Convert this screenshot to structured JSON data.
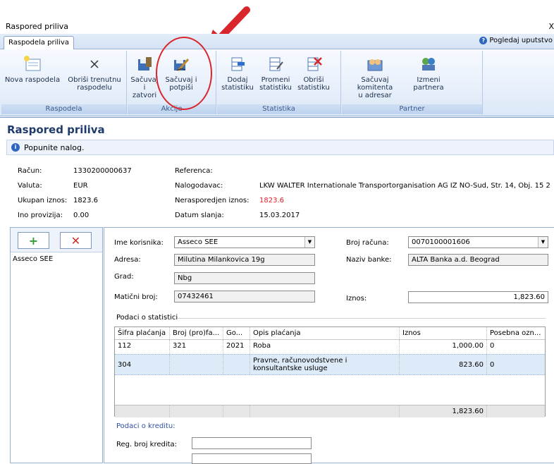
{
  "window": {
    "title": "Raspored priliva",
    "close": "X"
  },
  "tabs": {
    "active": "Raspodela priliva",
    "help": "Pogledaj uputstvo",
    "help_icon": "?"
  },
  "ribbon": {
    "groups": {
      "raspodela": "Raspodela",
      "akcije": "Akcije",
      "statistika": "Statistika",
      "partner": "Partner"
    },
    "buttons": {
      "nova": "Nova raspodela",
      "obrisi_a": "Obriši trenutnu",
      "obrisi_b": "raspodelu",
      "sacuvaj_zatvori_a": "Sačuvaj i",
      "sacuvaj_zatvori_b": "zatvori",
      "sacuvaj_potpisi_a": "Sačuvaj i",
      "sacuvaj_potpisi_b": "potpiši",
      "dodaj_a": "Dodaj",
      "dodaj_b": "statistiku",
      "promeni_a": "Promeni",
      "promeni_b": "statistiku",
      "obrisi_stat_a": "Obriši",
      "obrisi_stat_b": "statistiku",
      "sacuvaj_kom_a": "Sačuvaj komitenta",
      "sacuvaj_kom_b": "u adresar",
      "izmeni_a": "Izmeni",
      "izmeni_b": "partnera"
    }
  },
  "page": {
    "title": "Raspored priliva",
    "info": "Popunite nalog.",
    "info_icon": "i"
  },
  "summary": {
    "racun_l": "Račun:",
    "racun_v": "1330200000637",
    "valuta_l": "Valuta:",
    "valuta_v": "EUR",
    "ukupan_l": "Ukupan iznos:",
    "ukupan_v": "1823.6",
    "ino_l": "Ino provizija:",
    "ino_v": "0.00",
    "referenca_l": "Referenca:",
    "referenca_v": "",
    "nalogodavac_l": "Nalogodavac:",
    "nalogodavac_v": "LKW WALTER Internationale Transportorganisation AG IZ NO-Sud, Str. 14, Obj. 15 2",
    "neraspored_l": "Nerasporedjen iznos:",
    "neraspored_v": "1823.6",
    "datum_l": "Datum slanja:",
    "datum_v": "15.03.2017"
  },
  "left": {
    "add": "+",
    "remove": "✕",
    "items": [
      "Asseco SEE"
    ]
  },
  "form": {
    "ime_l": "Ime korisnika:",
    "ime_v": "Asseco SEE",
    "adresa_l": "Adresa:",
    "adresa_v": "Milutina Milankovica 19g",
    "grad_l": "Grad:",
    "grad_v": "Nbg",
    "mb_l": "Matični broj:",
    "mb_v": "07432461",
    "broj_racuna_l": "Broj računa:",
    "broj_racuna_v": "0070100001606",
    "naziv_banke_l": "Naziv banke:",
    "naziv_banke_v": "ALTA Banka a.d. Beograd",
    "iznos_l": "Iznos:",
    "iznos_v": "1,823.60",
    "stat_section": "Podaci o statistici",
    "kredit_section": "Podaci o kreditu:",
    "reg_kredit_l": "Reg. broj kredita:"
  },
  "table": {
    "headers": [
      "Šifra plaćanja",
      "Broj (pro)fa...",
      "Go...",
      "Opis plaćanja",
      "Iznos",
      "Posebna ozn..."
    ],
    "rows": [
      [
        "112",
        "321",
        "2021",
        "Roba",
        "1,000.00",
        "0"
      ],
      [
        "304",
        "",
        "",
        "Pravne, računovodstvene i konsultantske usluge",
        "823.60",
        "0"
      ]
    ],
    "total": "1,823.60"
  },
  "colors": {
    "accent": "#1f3b6d",
    "red_arrow": "#d9262c",
    "negative": "#e0202a"
  }
}
